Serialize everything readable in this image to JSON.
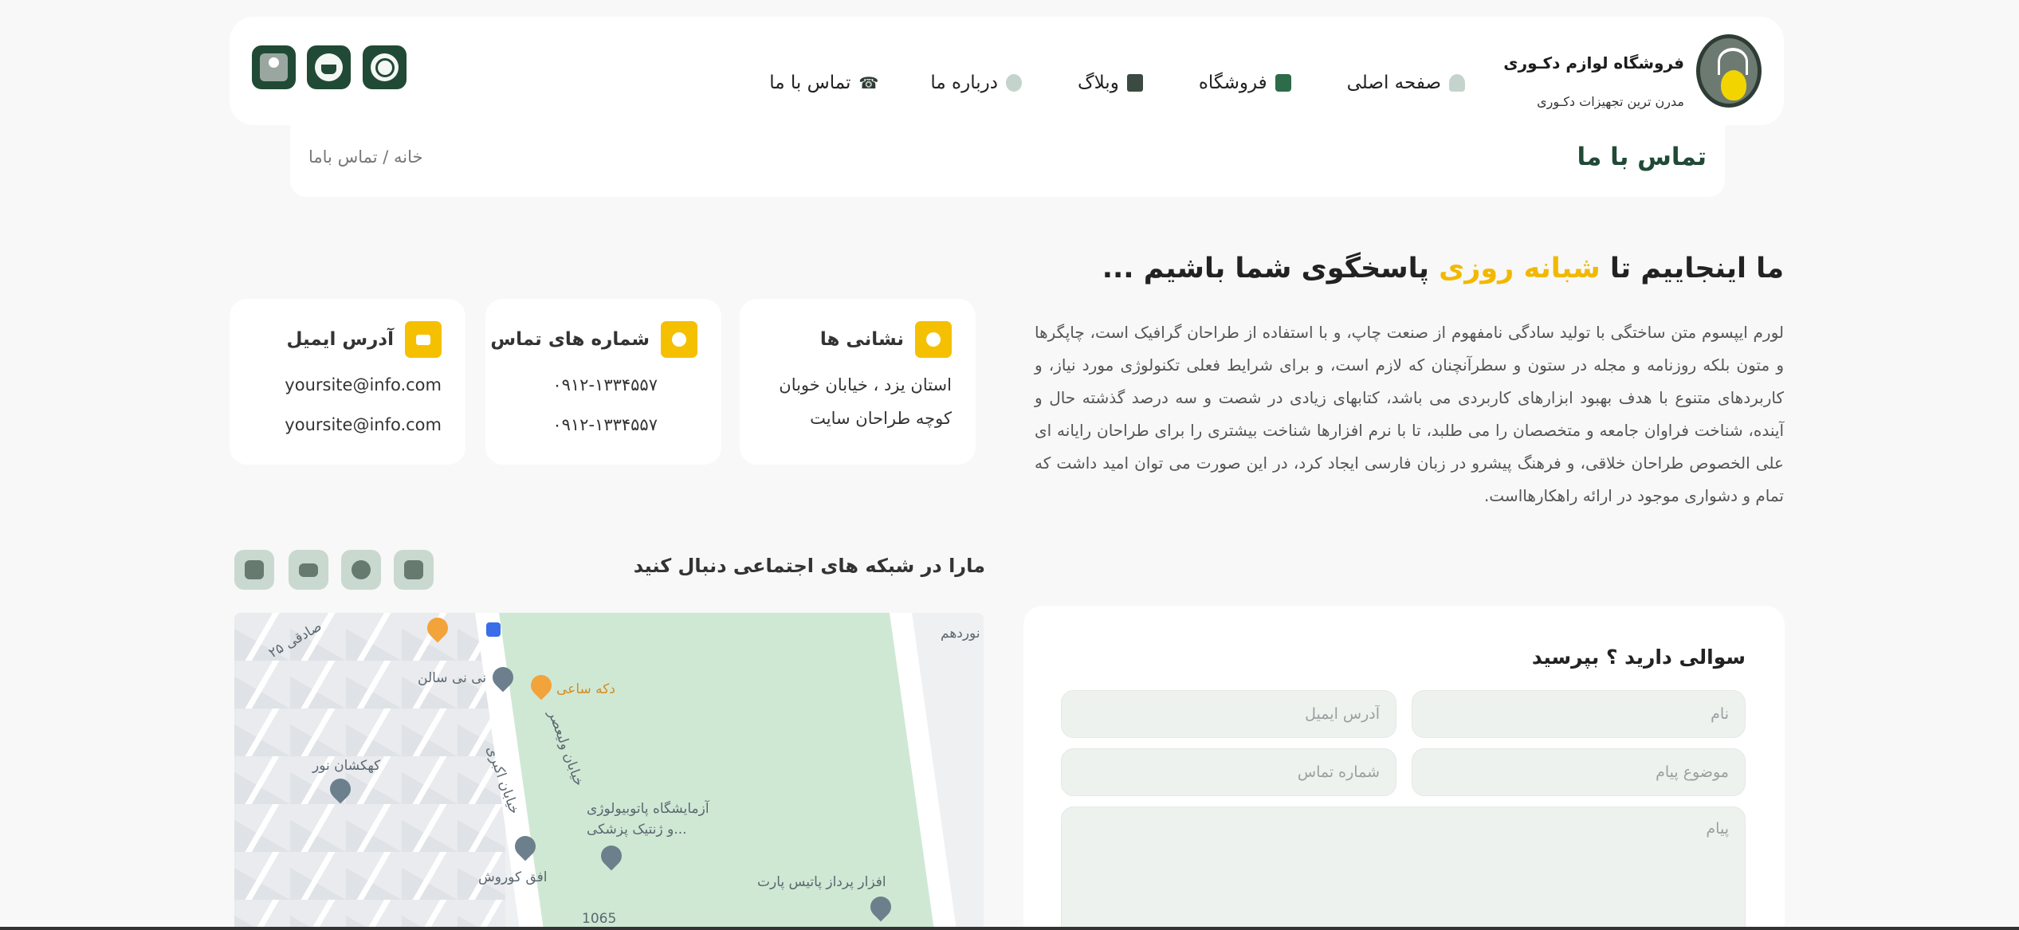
{
  "header": {
    "brand_title": "فروشگاه لوازم دکـوری",
    "brand_subtitle": "مدرن ترین تجهیزات دکـوری",
    "nav": [
      {
        "label": "صفحه اصلی",
        "icon": "home-icon"
      },
      {
        "label": "فروشگاه",
        "icon": "shop-icon"
      },
      {
        "label": "وبلاگ",
        "icon": "blog-icon"
      },
      {
        "label": "درباره ما",
        "icon": "info-icon"
      },
      {
        "label": "تماس با ما",
        "icon": "phone-icon"
      }
    ],
    "accent": "#204a35"
  },
  "breadcrumb": {
    "title": "تماس با ما",
    "trail": "خانه / تماس باما"
  },
  "hero": {
    "headline_before": "ما اینجاییم تا",
    "headline_highlight": "شبانه روزی",
    "headline_after": "پاسخگوی شما باشیم ...",
    "highlight_color": "#f2b800",
    "paragraph": "لورم ایپسوم متن ساختگی با تولید سادگی نامفهوم از صنعت چاپ، و با استفاده از طراحان گرافیک است، چاپگرها و متون بلکه روزنامه و مجله در ستون و سطرآنچنان که لازم است، و برای شرایط فعلی تکنولوژی مورد نیاز، و کاربردهای متنوع با هدف بهبود ابزارهای کاربردی می باشد، کتابهای زیادی در شصت و سه درصد گذشته حال و آینده، شناخت فراوان جامعه و متخصصان را می طلبد، تا با نرم افزارها شناخت بیشتری را برای طراحان رایانه ای علی الخصوص طراحان خلاقی، و فرهنگ پیشرو در زبان فارسی ایجاد کرد، در این صورت می توان امید داشت که تمام و دشواری موجود در ارائه راهکارهااست."
  },
  "contact_cards": {
    "address": {
      "title": "نشانی ها",
      "line1": "استان یزد ، خیابان خوبان",
      "line2": "کوچه طراحان سایت"
    },
    "phones": {
      "title": "شماره های تماس",
      "line1": "۰۹۱۲-۱۳۳۴۵۵۷",
      "line2": "۰۹۱۲-۱۳۳۴۵۵۷"
    },
    "email": {
      "title": "آدرس ایمیل",
      "line1": "yoursite@info.com",
      "line2": "yoursite@info.com"
    }
  },
  "social": {
    "title": "مارا در شبکه های اجتماعی دنبال کنید",
    "icons": [
      "facebook-icon",
      "whatsapp-icon",
      "youtube-icon",
      "instagram-icon"
    ]
  },
  "map": {
    "labels": [
      "دکه ساعی",
      "نی نی سالن",
      "کهکشان نور",
      "آزمایشگاه پاتوبیولوژی",
      "و ژنتیک پزشکی...",
      "افق کوروش",
      "افزار پرداز پاتیس پارت",
      "خیابان ولیعصر",
      "خیابان اکبری",
      "صادقی ۲۵",
      "نوردهم",
      "1065"
    ]
  },
  "form": {
    "title": "سوالی دارید ؟ بپرسید",
    "name_placeholder": "نام",
    "email_placeholder": "آدرس ایمیل",
    "subject_placeholder": "موضوع پیام",
    "phone_placeholder": "شماره تماس",
    "message_placeholder": "پیام"
  }
}
